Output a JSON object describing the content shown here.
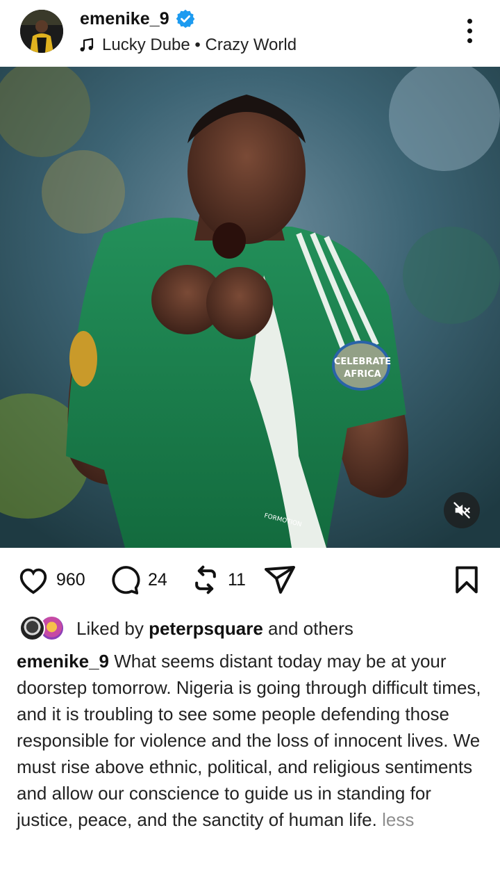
{
  "post": {
    "username": "emenike_9",
    "verified": true,
    "music": {
      "artist": "Lucky Dube",
      "separator": "•",
      "track": "Crazy World"
    },
    "media": {
      "badge_text_line1": "CELEBRATE",
      "badge_text_line2": "AFRICA",
      "shirt_brand": "FORMOTION",
      "muted": true
    },
    "actions": {
      "likes": "960",
      "comments": "24",
      "reposts": "11"
    },
    "liked_by": {
      "prefix": "Liked by",
      "user": "peterpsquare",
      "suffix": "and others"
    },
    "caption": {
      "username": "emenike_9",
      "text": "What seems distant today may be at your doorstep tomorrow. Nigeria is going through difficult times, and  it is troubling to see some people defending those responsible for violence and the loss of innocent lives. We must rise above ethnic, political, and religious sentiments and allow our conscience to guide us in standing for justice, peace, and the sanctity of human life.",
      "less_label": "less"
    }
  },
  "colors": {
    "verified_blue": "#1d9bf0",
    "jersey_green": "#1c7a4a",
    "text_primary": "#111111",
    "text_muted": "#8e8e8e"
  },
  "icons": [
    "verified-badge-icon",
    "music-note-icon",
    "more-options-icon",
    "mute-icon",
    "heart-icon",
    "comment-icon",
    "repost-icon",
    "share-icon",
    "bookmark-icon"
  ]
}
